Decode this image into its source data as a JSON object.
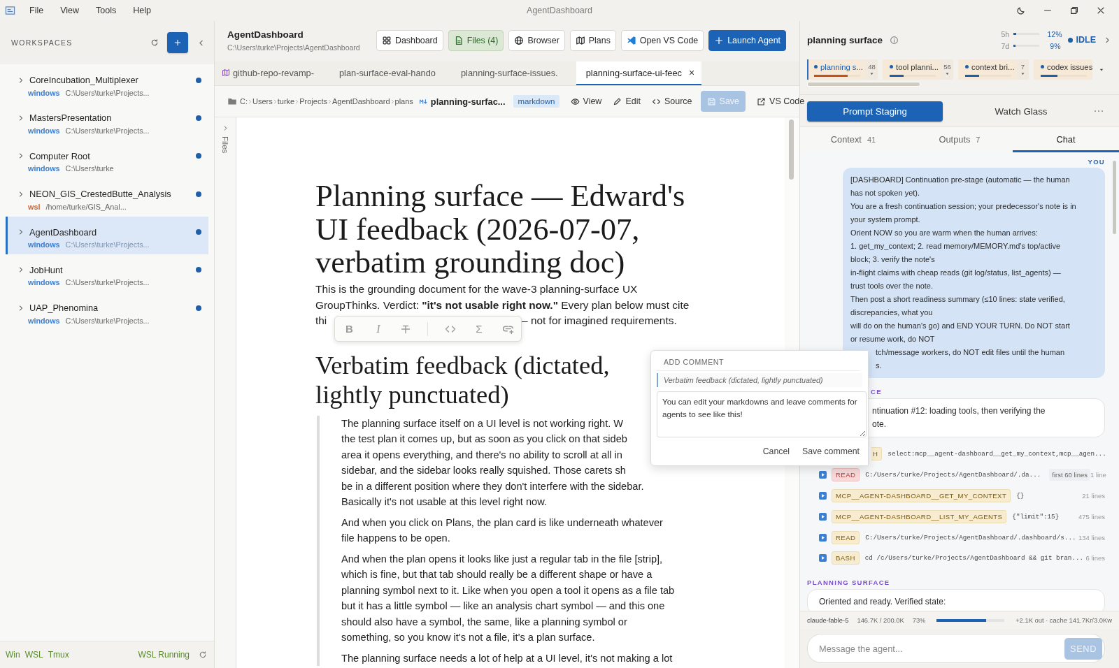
{
  "window": {
    "title": "AgentDashboard",
    "menu": [
      "File",
      "View",
      "Tools",
      "Help"
    ]
  },
  "sidebar": {
    "title": "WORKSPACES",
    "items": [
      {
        "name": "CoreIncubation_Multiplexer",
        "env": "windows",
        "color": "#3b7fd4",
        "path": "C:\\Users\\turke\\Projects...",
        "selected": false
      },
      {
        "name": "MastersPresentation",
        "env": "windows",
        "color": "#3b7fd4",
        "path": "C:\\Users\\turke\\Projects...",
        "selected": false
      },
      {
        "name": "Computer Root",
        "env": "windows",
        "color": "#3b7fd4",
        "path": "C:\\Users\\turke",
        "selected": false
      },
      {
        "name": "NEON_GIS_CrestedButte_Analysis",
        "env": "wsl",
        "color": "#d2622f",
        "path": "/home/turke/GIS_Anal...",
        "selected": false
      },
      {
        "name": "AgentDashboard",
        "env": "windows",
        "color": "#3b7fd4",
        "path": "C:\\Users\\turke\\Projects...",
        "selected": true
      },
      {
        "name": "JobHunt",
        "env": "windows",
        "color": "#3b7fd4",
        "path": "C:\\Users\\turke\\Projects...",
        "selected": false
      },
      {
        "name": "UAP_Phenomina",
        "env": "windows",
        "color": "#3b7fd4",
        "path": "C:\\Users\\turke\\Projects...",
        "selected": false
      }
    ],
    "footer": {
      "toggles": [
        "Win",
        "WSL",
        "Tmux"
      ],
      "status": "WSL Running"
    }
  },
  "header": {
    "title": "AgentDashboard",
    "path": "C:\\Users\\turke\\Projects\\AgentDashboard",
    "buttons": [
      {
        "label": "Dashboard",
        "kind": "dashboard",
        "selected": false
      },
      {
        "label": "Files (4)",
        "kind": "files",
        "selected": true
      },
      {
        "label": "Browser",
        "kind": "browser",
        "selected": false
      },
      {
        "label": "Plans",
        "kind": "plans",
        "selected": false
      },
      {
        "label": "Open VS Code",
        "kind": "vscode",
        "selected": false
      },
      {
        "label": "Launch Agent",
        "kind": "launch"
      }
    ]
  },
  "tabs": [
    {
      "label": "github-repo-revamp-",
      "kind": "plan",
      "selected": false
    },
    {
      "label": "plan-surface-eval-hando",
      "kind": "file",
      "selected": false
    },
    {
      "label": "planning-surface-issues.",
      "kind": "file",
      "selected": false
    },
    {
      "label": "planning-surface-ui-feec",
      "kind": "file",
      "selected": true,
      "close": "×"
    }
  ],
  "doc_toolbar": {
    "breadcrumb": [
      "C:",
      "Users",
      "turke",
      "Projects",
      "AgentDashboard",
      "plans"
    ],
    "filename": "planning-surfac...",
    "badge": "markdown",
    "actions": [
      {
        "label": "View",
        "kind": "view",
        "disabled": false
      },
      {
        "label": "Edit",
        "kind": "edit",
        "disabled": false
      },
      {
        "label": "Source",
        "kind": "source",
        "disabled": false
      },
      {
        "label": "Save",
        "kind": "save",
        "disabled": true
      },
      {
        "label": "VS Code",
        "kind": "external",
        "disabled": false
      }
    ]
  },
  "files_rail": {
    "label": "Files"
  },
  "document": {
    "blocks": [
      {
        "kind": "h1",
        "lines": [
          "Planning surface — Edward's",
          "UI feedback (2026-07-07,",
          "verbatim grounding doc)"
        ]
      },
      {
        "kind": "p",
        "lines": [
          "This is the grounding document for the wave-3 planning-surface UX",
          "GroupThinks. Verdict: **\"it's not usable right now.\"** Every plan below must cite",
          [
            "thi",
            "— not for imagined requirements."
          ]
        ]
      },
      {
        "kind": "h2",
        "lines": [
          "Verbatim feedback (dictated,",
          "lightly punctuated)"
        ]
      },
      {
        "kind": "quote",
        "paragraphs": [
          [
            "The planning surface itself on a UI level is not working right. W",
            "the test plan it comes up, but as soon as you click on that sideb",
            "area it opens everything, and there's no ability to scroll at all in",
            "sidebar, and the sidebar looks really squished. Those carets sh",
            "be in a different position where they don't interfere with the sidebar.",
            "Basically it's not usable at this level right now."
          ],
          [
            "And when you click on Plans, the plan card is like underneath whatever",
            "file happens to be open."
          ],
          [
            "And when the plan opens it looks like just a regular tab in the file [strip],",
            "which is fine, but that tab should really be a different shape or have a",
            "planning symbol next to it. Like when you open a tool it opens as a file tab",
            "but it has a little symbol — like an analysis chart symbol — and this one",
            "should also have a symbol, the same, like a planning symbol or",
            "something, so you know it's not a file, it's a plan surface."
          ],
          [
            "The planning surface needs a lot of help at a UI level, it's not making a lot"
          ]
        ]
      }
    ]
  },
  "format_toolbar": {
    "buttons": [
      {
        "kind": "bold",
        "label": "B"
      },
      {
        "kind": "italic",
        "label": "I"
      },
      {
        "kind": "strike"
      },
      {
        "kind": "code"
      },
      {
        "kind": "math",
        "label": "Σ"
      },
      {
        "kind": "link"
      }
    ]
  },
  "comment_popup": {
    "title": "ADD COMMENT",
    "quote": "Verbatim feedback (dictated, lightly punctuated)",
    "value": "You can edit your markdowns and leave comments for agents to see like this!",
    "actions": [
      "Cancel",
      "Save comment"
    ]
  },
  "agent_panel": {
    "title": "planning surface",
    "usage": [
      {
        "label": "5h",
        "level": 0.12,
        "reading": "12%"
      },
      {
        "label": "7d",
        "level": 0.09,
        "reading": "9%"
      }
    ],
    "status": "IDLE",
    "agents": [
      {
        "label": "planning s...",
        "count": "48",
        "level": 0.72,
        "color": "#c4501c",
        "selected": true
      },
      {
        "label": "tool planni...",
        "count": "56",
        "level": 0.3,
        "color": "#1f5fa8",
        "selected": false
      },
      {
        "label": "context bri...",
        "count": "7",
        "level": 0.3,
        "color": "#1f5fa8",
        "selected": false
      },
      {
        "label": "codex issues",
        "level": 0.37,
        "color": "#1f5fa8",
        "selected": false
      }
    ],
    "modes": [
      {
        "label": "Prompt Staging",
        "selected": true
      },
      {
        "label": "Watch Glass",
        "selected": false
      }
    ],
    "tabs": [
      {
        "label": "Context",
        "count": "41",
        "selected": false
      },
      {
        "label": "Outputs",
        "count": "7",
        "selected": false
      },
      {
        "label": "Chat",
        "selected": true
      }
    ],
    "chat": [
      {
        "kind": "user",
        "author": "YOU",
        "lines": [
          "[DASHBOARD] Continuation pre-stage (automatic — the human",
          "has not spoken yet).",
          "You are a fresh continuation session; your predecessor's note is in",
          "your system prompt.",
          "Orient NOW so you are warm when the human arrives:",
          "1. get_my_context; 2. read memory/MEMORY.md's top/active",
          "block; 3. verify the note's",
          "in-flight claims with cheap reads (git log/status, list_agents) —",
          "trust tools over the note.",
          "Then post a short readiness summary (≤10 lines: state verified,",
          "discrepancies, what you",
          "will do on the human's go) and END YOUR TURN. Do NOT start",
          "or resume work, do NOT",
          {
            "text": "tch/message workers, do NOT edit files until the human",
            "partial": true
          },
          {
            "text": "s.",
            "partial": true
          }
        ]
      },
      {
        "kind": "agent",
        "author": "CE",
        "partial": true,
        "lines": [
          {
            "text": "ntinuation #12: loading tools, then verifying the",
            "partial": true
          },
          {
            "text": "ote.",
            "partial": true
          }
        ]
      },
      {
        "kind": "tools",
        "rows": [
          {
            "tool": "H",
            "partial": true,
            "error": false,
            "args": "select:mcp__agent-dashboard__get_my_context,mcp__agen..."
          },
          {
            "tool": "READ",
            "error": true,
            "args": "C:/Users/turke/Projects/AgentDashboard/.da...",
            "note": "first 60 lines",
            "size": "1 line"
          },
          {
            "tool": "MCP__AGENT-DASHBOARD__GET_MY_CONTEXT",
            "error": false,
            "args": "{}",
            "size": "21 lines"
          },
          {
            "tool": "MCP__AGENT-DASHBOARD__LIST_MY_AGENTS",
            "error": false,
            "args": "{\"limit\":15}",
            "size": "475 lines"
          },
          {
            "tool": "READ",
            "error": false,
            "args": "C:/Users/turke/Projects/AgentDashboard/.dashboard/s...",
            "size": "134 lines"
          },
          {
            "tool": "BASH",
            "error": false,
            "args": "cd /c/Users/turke/Projects/AgentDashboard && git bran...",
            "size": "6 lines"
          }
        ]
      },
      {
        "kind": "agent",
        "author": "PLANNING SURFACE",
        "lines": [
          "Oriented and ready. Verified state:"
        ]
      }
    ],
    "status_bar": {
      "model": "claude-fable-5",
      "tokens": "146.7K / 200.0K",
      "percent": "73%",
      "level": 0.73,
      "cache": "+2.1K out · cache 141.7Kr/3.0Kw"
    },
    "composer": {
      "placeholder": "Message the agent...",
      "send": "SEND",
      "send_disabled": true
    }
  }
}
